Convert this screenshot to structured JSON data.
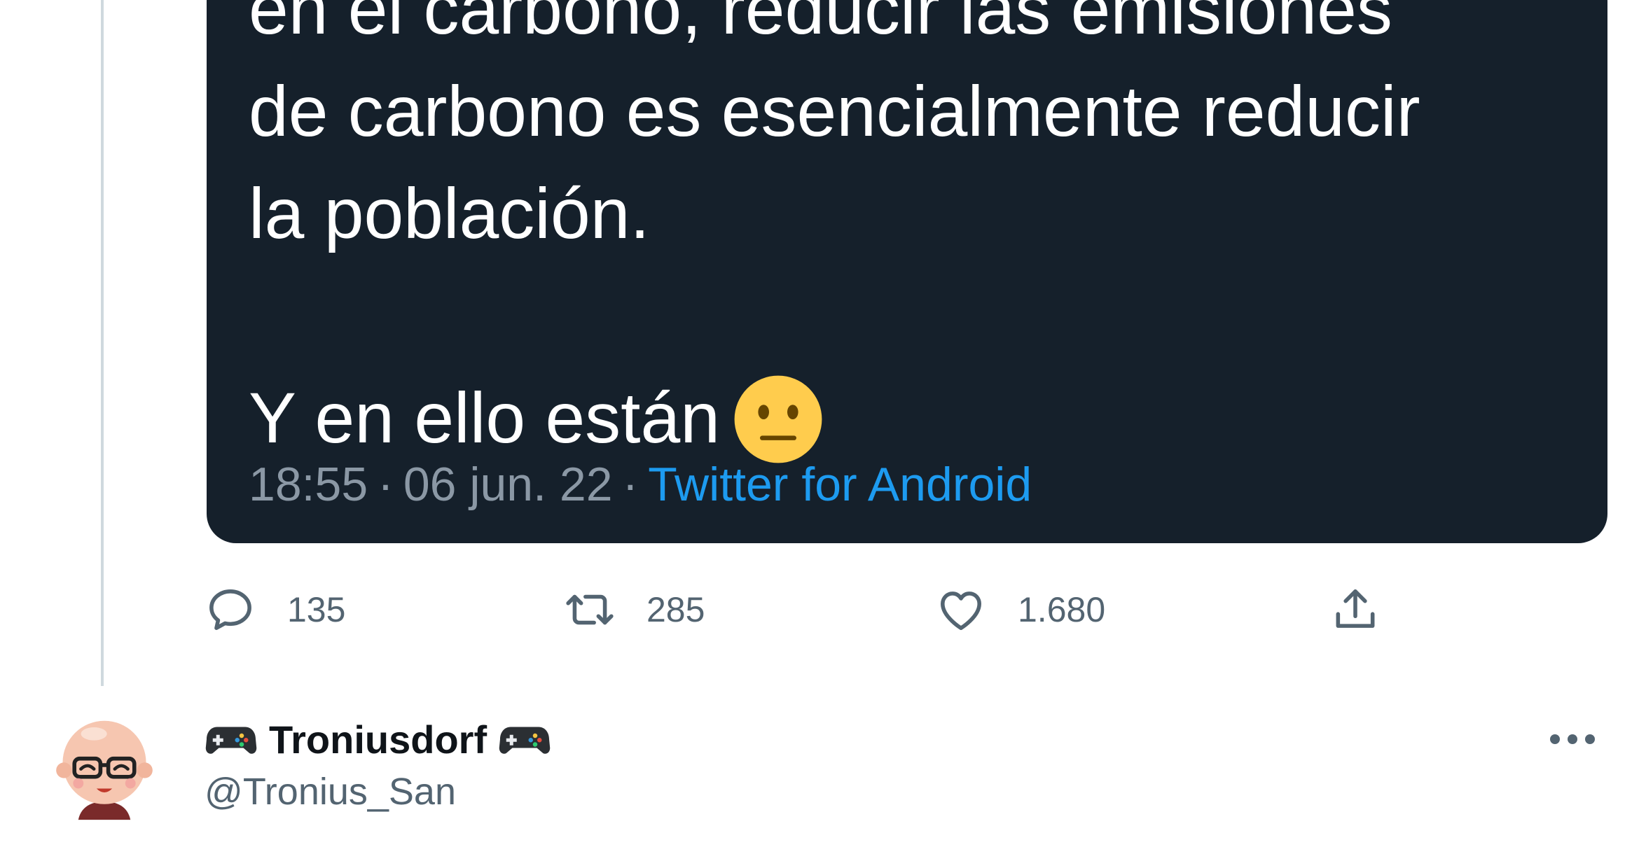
{
  "tweet": {
    "text_lines": [
      "en el carbono, reducir las emisiones",
      "de carbono es esencialmente reducir",
      "la población.",
      "Y en ello están"
    ],
    "emoji": "neutral-face-emoji",
    "time": "18:55",
    "date": "06 jun. 22",
    "separator": "·",
    "source": "Twitter for Android"
  },
  "actions": {
    "replies": "135",
    "retweets": "285",
    "likes": "1.680"
  },
  "reply_author": {
    "name": "Troniusdorf",
    "handle": "@Tronius_San",
    "name_icon": "game-controller-icon"
  },
  "colors": {
    "card_bg": "#15202b",
    "link_blue": "#1d9bf0",
    "meta_gray": "#8b98a5",
    "action_gray": "#536471",
    "thread_line": "#cfd9de"
  }
}
